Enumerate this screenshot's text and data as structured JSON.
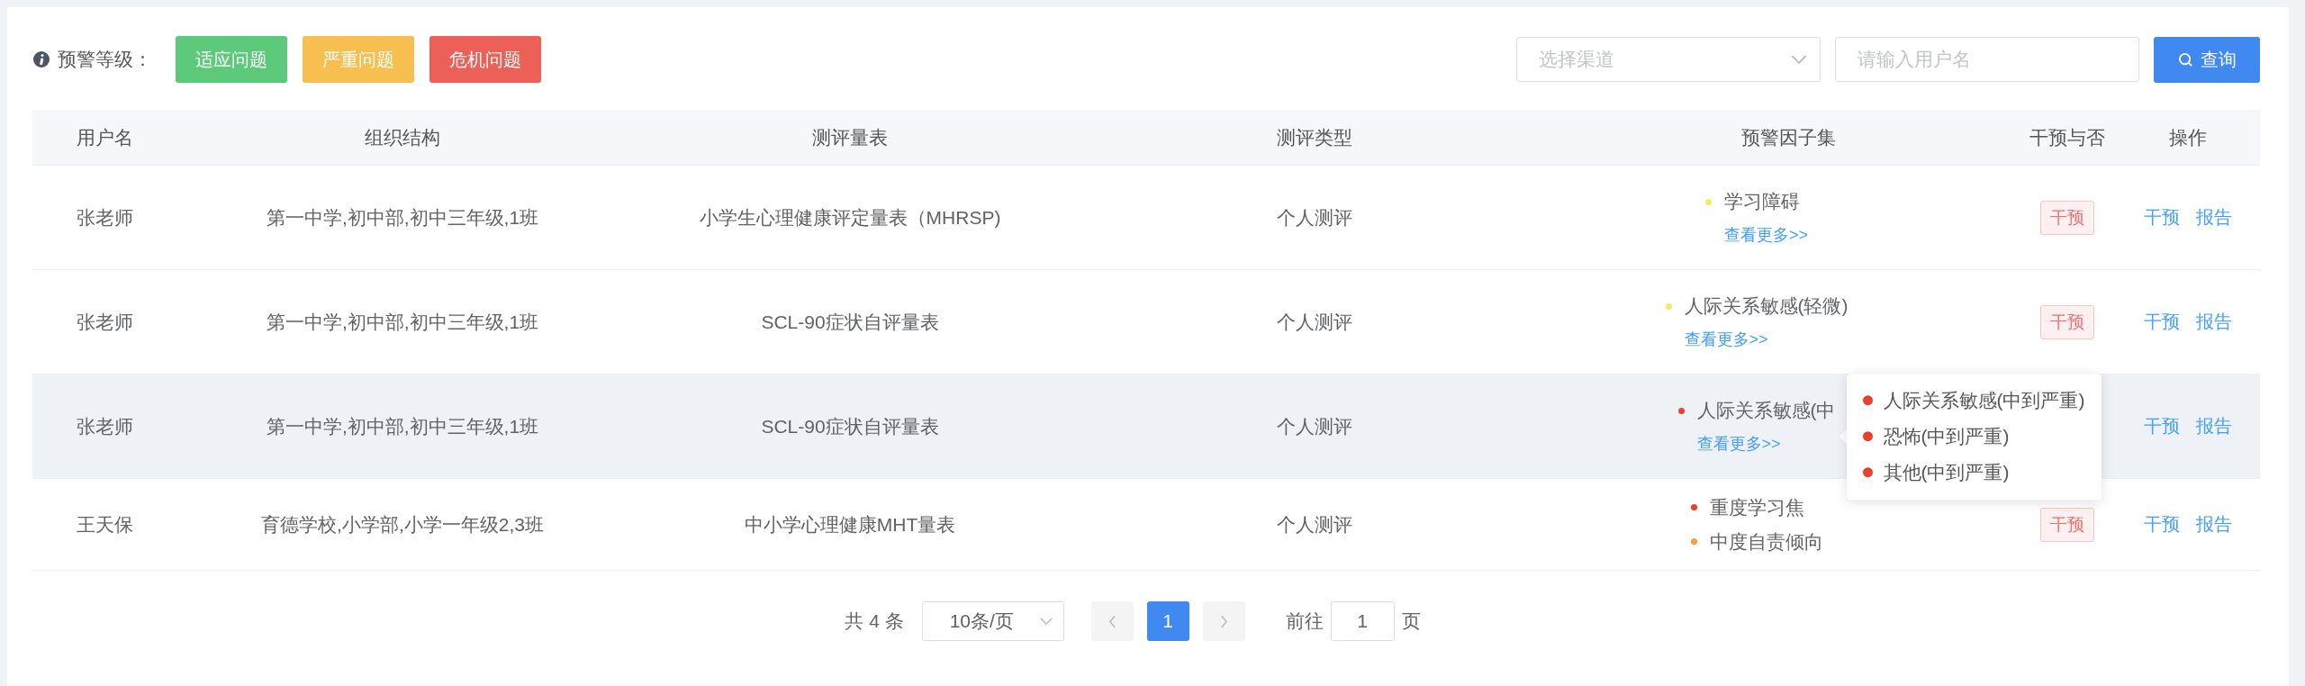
{
  "warning_levels": {
    "label": "预警等级：",
    "buttons": [
      {
        "label": "适应问题",
        "color": "#5dc97a"
      },
      {
        "label": "严重问题",
        "color": "#f6bf50"
      },
      {
        "label": "危机问题",
        "color": "#ec6058"
      }
    ]
  },
  "filters": {
    "channel_placeholder": "选择渠道",
    "username_placeholder": "请输入用户名",
    "search_button": "查询"
  },
  "table": {
    "columns": [
      "用户名",
      "组织结构",
      "测评量表",
      "测评类型",
      "预警因子集",
      "干预与否",
      "操作"
    ],
    "rows": [
      {
        "username": "张老师",
        "organization": "第一中学,初中部,初中三年级,1班",
        "scale": "小学生心理健康评定量表（MHRSP)",
        "type": "个人测评",
        "factors": [
          {
            "name": "学习障碍",
            "color": "#f7ea5c"
          }
        ],
        "more_link": "查看更多>>",
        "intervention": "干预",
        "actions": [
          "干预",
          "报告"
        ],
        "highlighted": false
      },
      {
        "username": "张老师",
        "organization": "第一中学,初中部,初中三年级,1班",
        "scale": "SCL-90症状自评量表",
        "type": "个人测评",
        "factors": [
          {
            "name": "人际关系敏感(轻微)",
            "color": "#f7ea5c"
          }
        ],
        "more_link": "查看更多>>",
        "intervention": "干预",
        "actions": [
          "干预",
          "报告"
        ],
        "highlighted": false
      },
      {
        "username": "张老师",
        "organization": "第一中学,初中部,初中三年级,1班",
        "scale": "SCL-90症状自评量表",
        "type": "个人测评",
        "factors": [
          {
            "name": "人际关系敏感(中",
            "color": "#e8412c"
          }
        ],
        "more_link": "查看更多>>",
        "actions": [
          "干预",
          "报告"
        ],
        "highlighted": true,
        "popover": {
          "items": [
            {
              "name": "人际关系敏感(中到严重)",
              "color": "#e8412c"
            },
            {
              "name": "恐怖(中到严重)",
              "color": "#e8412c"
            },
            {
              "name": "其他(中到严重)",
              "color": "#e8412c"
            }
          ]
        }
      },
      {
        "username": "王天保",
        "organization": "育德学校,小学部,小学一年级2,3班",
        "scale": "中小学心理健康MHT量表",
        "type": "个人测评",
        "factors": [
          {
            "name": "重度学习焦",
            "color": "#e8412c"
          },
          {
            "name": "中度自责倾向",
            "color": "#f0a040"
          }
        ],
        "intervention": "干预",
        "actions": [
          "干预",
          "报告"
        ],
        "highlighted": false
      }
    ]
  },
  "pagination": {
    "total": "共 4 条",
    "page_size": "10条/页",
    "pages": [
      {
        "label": "1",
        "selected": true
      }
    ],
    "goto_label": "前往",
    "goto_value": "1",
    "page_suffix": "页"
  }
}
